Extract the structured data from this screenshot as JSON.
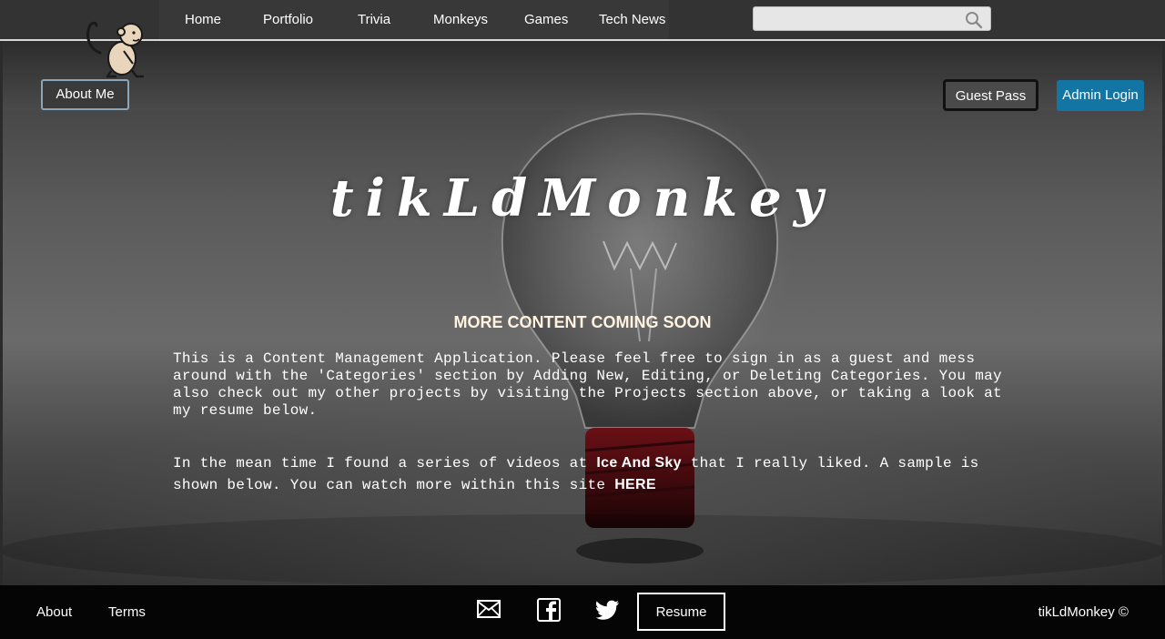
{
  "nav": {
    "items": [
      {
        "label": "Home"
      },
      {
        "label": "Portfolio"
      },
      {
        "label": "Trivia"
      },
      {
        "label": "Monkeys"
      },
      {
        "label": "Games"
      },
      {
        "label": "Tech News"
      }
    ],
    "search": {
      "value": "",
      "placeholder": "",
      "icon": "search-icon"
    }
  },
  "logo": {
    "icon": "monkey-logo-icon"
  },
  "hero": {
    "about_button": "About Me",
    "guest_button": "Guest Pass",
    "admin_button": "Admin Login",
    "admin_color": "#1275a3",
    "title": "tikLdMonkey",
    "coming_soon": "MORE CONTENT COMING SOON",
    "paragraph1": "This is a Content Management Application. Please feel free to sign in as a guest and mess around with the 'Categories' section by Adding New, Editing, or Deleting Categories. You may also check out my other projects by visiting the Projects section above, or taking a look at my resume below.",
    "paragraph2": {
      "before": "In the mean time I found a series of videos at ",
      "link1": "Ice And Sky",
      "middle": " that I really liked. A sample is shown below. You can watch more within this site ",
      "link2": "HERE"
    }
  },
  "footer": {
    "about": "About",
    "terms": "Terms",
    "social": [
      "mail-icon",
      "facebook-icon",
      "twitter-icon"
    ],
    "resume_button": "Resume",
    "copyright": "tikLdMonkey ©"
  }
}
